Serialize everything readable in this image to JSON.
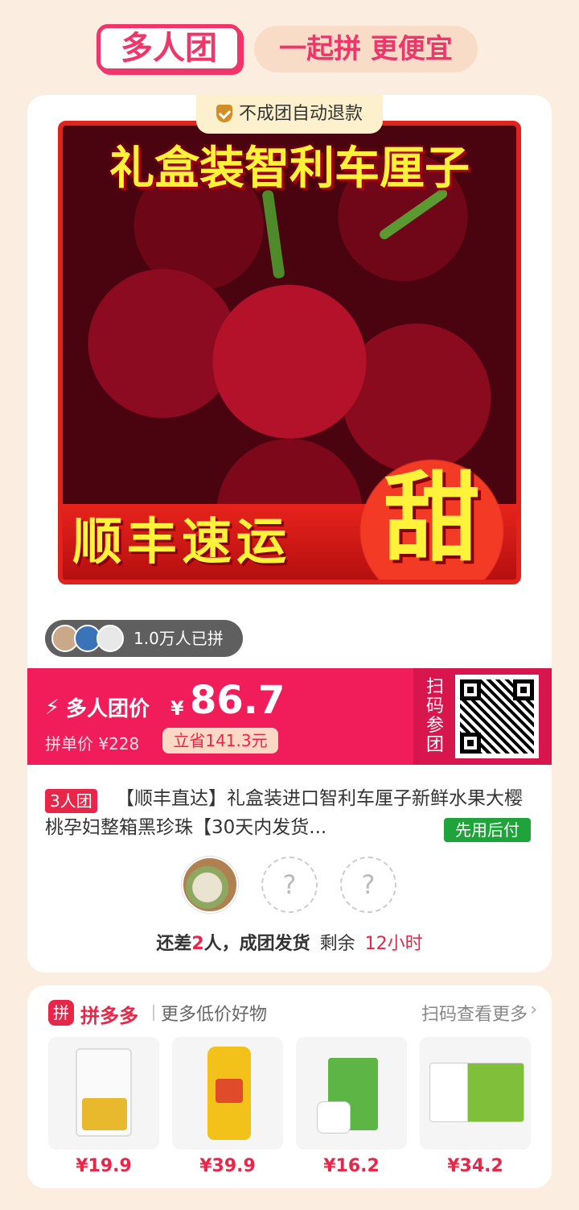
{
  "header": {
    "brand": "多人团",
    "slogan": "一起拼 更便宜"
  },
  "product": {
    "refund_badge": "不成团自动退款",
    "image_title": "礼盒装智利车厘子",
    "image_bottom_text": "顺丰速运",
    "image_sweet": "甜",
    "buyers_count": "1.0万人已拼",
    "price_label": "多人团价",
    "currency": "¥",
    "price": "86.7",
    "single_price": "拼单价 ¥228",
    "save_tag": "立省141.3元",
    "qr_label": "扫码参团",
    "group_tag": "3人团",
    "title": "【顺丰直达】礼盒装进口智利车厘子新鲜水果大樱桃孕妇整箱黑珍珠【30天内发货...",
    "pay_later": "先用后付"
  },
  "group": {
    "empty_slot_mark": "?",
    "status_prefix": "还差",
    "status_count": "2",
    "status_suffix": "人，成团发货",
    "remaining_label": "剩余",
    "remaining_time": "12小时"
  },
  "recommend": {
    "logo_text": "拼",
    "brand": "拼多多",
    "subtitle": "更多低价好物",
    "more": "扫码查看更多",
    "chevron": "›",
    "items": [
      {
        "name": "rice",
        "price": "¥19.9"
      },
      {
        "name": "cooking-oil",
        "price": "¥39.9"
      },
      {
        "name": "tissue",
        "price": "¥16.2"
      },
      {
        "name": "milk",
        "price": "¥34.2"
      }
    ]
  },
  "colors": {
    "accent": "#f01d5a",
    "background": "#fbeee0",
    "green": "#1fa33a"
  }
}
